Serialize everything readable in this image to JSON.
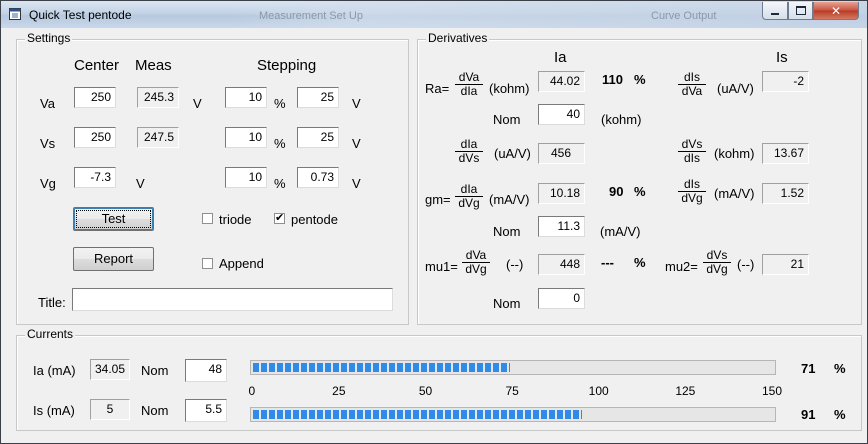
{
  "window": {
    "title": "Quick Test pentode"
  },
  "background_titles": [
    "Measurement Set Up",
    "Curve Output"
  ],
  "settings": {
    "group_title": "Settings",
    "headers": {
      "center": "Center",
      "meas": "Meas",
      "stepping": "Stepping"
    },
    "rows": [
      {
        "label": "Va",
        "center": "250",
        "meas": "245.3",
        "meas_unit": "V",
        "step_pct": "10",
        "pct": "%",
        "step_abs": "25",
        "abs_unit": "V"
      },
      {
        "label": "Vs",
        "center": "250",
        "meas": "247.5",
        "meas_unit": "",
        "step_pct": "10",
        "pct": "%",
        "step_abs": "25",
        "abs_unit": "V"
      },
      {
        "label": "Vg",
        "center": "-7.3",
        "meas": "",
        "meas_unit": "V",
        "step_pct": "10",
        "pct": "%",
        "step_abs": "0.73",
        "abs_unit": "V"
      }
    ],
    "test_button": "Test",
    "report_button": "Report",
    "triode": {
      "label": "triode",
      "checked": false
    },
    "pentode": {
      "label": "pentode",
      "checked": true
    },
    "append": {
      "label": "Append",
      "checked": false
    },
    "title_label": "Title:",
    "title_value": ""
  },
  "derivatives": {
    "group_title": "Derivatives",
    "col_ia": "Ia",
    "col_is": "Is",
    "ra": {
      "prefix": "Ra=",
      "num": "dVa",
      "den": "dIa",
      "unit": "(kohm)",
      "value": "44.02",
      "pct": "110",
      "pct_sign": "%",
      "nom_label": "Nom",
      "nom": "40",
      "nom_unit": "(kohm)"
    },
    "dis_dva": {
      "num": "dIs",
      "den": "dVa",
      "unit": "(uA/V)",
      "value": "-2"
    },
    "dia_dvs": {
      "num": "dIa",
      "den": "dVs",
      "unit": "(uA/V)",
      "value": "456"
    },
    "dvs_dis": {
      "num": "dVs",
      "den": "dIs",
      "unit": "(kohm)",
      "value": "13.67"
    },
    "gm": {
      "prefix": "gm=",
      "num": "dIa",
      "den": "dVg",
      "unit": "(mA/V)",
      "value": "10.18",
      "pct": "90",
      "pct_sign": "%",
      "nom_label": "Nom",
      "nom": "11.3",
      "nom_unit": "(mA/V)"
    },
    "dis_dvg": {
      "num": "dIs",
      "den": "dVg",
      "unit": "(mA/V)",
      "value": "1.52"
    },
    "mu1": {
      "prefix": "mu1=",
      "num": "dVa",
      "den": "dVg",
      "unit": "(--)",
      "value": "448",
      "pct": "---",
      "pct_sign": "%",
      "nom_label": "Nom",
      "nom": "0"
    },
    "mu2": {
      "prefix": "mu2=",
      "num": "dVs",
      "den": "dVg",
      "unit": "(--)",
      "value": "21"
    }
  },
  "currents": {
    "group_title": "Currents",
    "ia": {
      "label": "Ia (mA)",
      "value": "34.05",
      "nom_label": "Nom",
      "nom": "48",
      "bar_value": 74,
      "pct": "71",
      "pct_sign": "%"
    },
    "is": {
      "label": "Is (mA)",
      "value": "5",
      "nom_label": "Nom",
      "nom": "5.5",
      "bar_value": 95,
      "pct": "91",
      "pct_sign": "%"
    },
    "scale": {
      "min": 0,
      "max": 150,
      "ticks": [
        "0",
        "25",
        "50",
        "75",
        "100",
        "125",
        "150"
      ]
    }
  }
}
